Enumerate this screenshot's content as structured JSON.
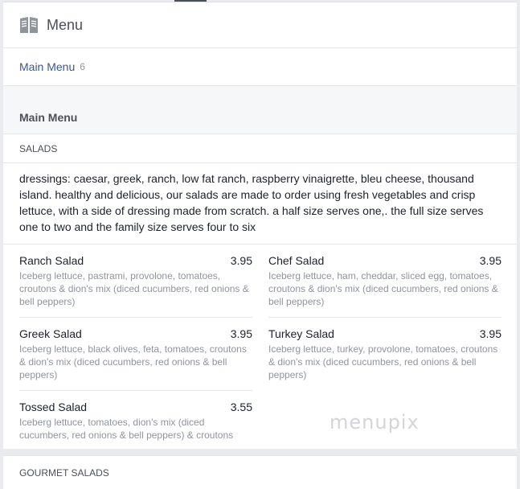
{
  "header": {
    "icon": "book-icon",
    "title": "Menu"
  },
  "tabs": [
    {
      "label": "Main Menu",
      "count": "6"
    }
  ],
  "section": {
    "title": "Main Menu"
  },
  "category": {
    "label": "SALADS",
    "description": "dressings: caesar, greek, ranch, low fat ranch, raspberry vinaigrette, bleu cheese, thousand island. healthy and delicious, our salads are made to order using fresh vegetables and crisp lettuce, with a side of dressing made from scratch. a half size serves one,. the full size serves one to two and the family size serves four to six"
  },
  "items": [
    {
      "name": "Ranch Salad",
      "price": "3.95",
      "desc": "Iceberg lettuce, pastrami, provolone, tomatoes, croutons & dion's mix (diced cucumbers, red onions & bell peppers)"
    },
    {
      "name": "Chef Salad",
      "price": "3.95",
      "desc": "Iceberg lettuce, ham, cheddar, sliced egg, tomatoes, croutons & dion's mix (diced cucumbers, red onions & bell peppers)"
    },
    {
      "name": "Greek Salad",
      "price": "3.95",
      "desc": "Iceberg lettuce, black olives, feta, tomatoes, croutons & dion's mix (diced cucumbers, red onions & bell peppers)"
    },
    {
      "name": "Turkey Salad",
      "price": "3.95",
      "desc": "Iceberg lettuce, turkey, provolone, tomatoes, croutons & dion's mix (diced cucumbers, red onions & bell peppers)"
    },
    {
      "name": "Tossed Salad",
      "price": "3.55",
      "desc": "Iceberg lettuce, tomatoes, dion's mix (diced cucumbers, red onions & bell peppers) & croutons"
    }
  ],
  "watermark": "menupix",
  "next_category": {
    "label": "GOURMET SALADS"
  }
}
